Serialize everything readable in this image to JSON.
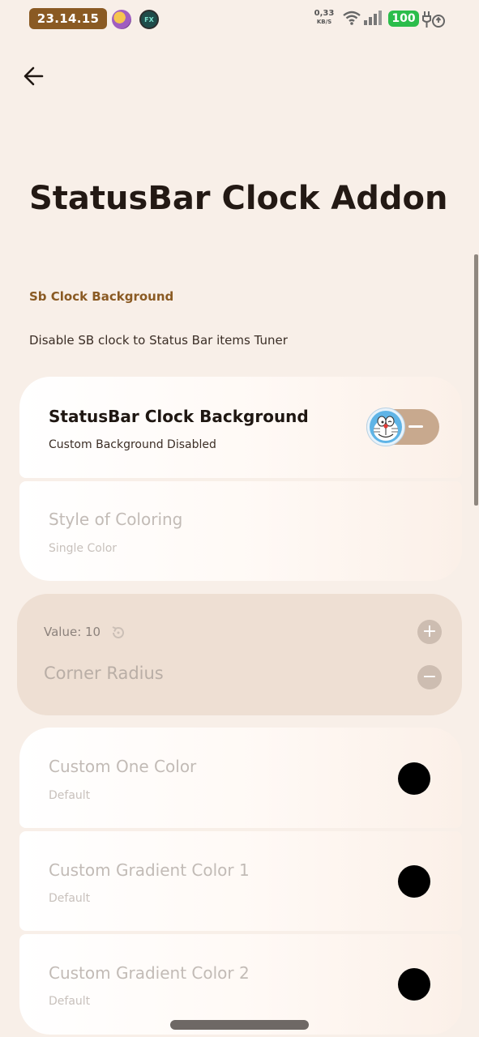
{
  "status_bar": {
    "time": "23.14.15",
    "app_icon_fx": "FX",
    "net_speed": "0,33",
    "net_unit": "KB/S",
    "battery": "100"
  },
  "header": {
    "title": "StatusBar Clock Addon"
  },
  "section": {
    "label": "Sb Clock Background",
    "description": "Disable SB clock to Status Bar items Tuner"
  },
  "settings": {
    "clock_background": {
      "title": "StatusBar Clock Background",
      "subtitle": "Custom Background Disabled"
    },
    "style_of_coloring": {
      "title": "Style of Coloring",
      "subtitle": "Single Color"
    },
    "corner_radius": {
      "value_label": "Value: 10",
      "title": "Corner Radius",
      "plus": "+",
      "minus": "−"
    },
    "custom_one_color": {
      "title": "Custom One Color",
      "subtitle": "Default"
    },
    "custom_gradient_1": {
      "title": "Custom Gradient Color 1",
      "subtitle": "Default"
    },
    "custom_gradient_2": {
      "title": "Custom Gradient Color 2",
      "subtitle": "Default"
    }
  },
  "colors": {
    "accent": "#8a5a23",
    "background": "#f8efe8",
    "battery": "#2bbd4b",
    "toggle_track": "#c8a98e",
    "slider_card": "#eedfd3",
    "picked_color": "#000000"
  },
  "icons": {
    "back": "arrow-left-icon",
    "wifi": "wifi-icon",
    "signal": "signal-icon",
    "charging": "charging-icon",
    "reset": "reset-icon"
  }
}
